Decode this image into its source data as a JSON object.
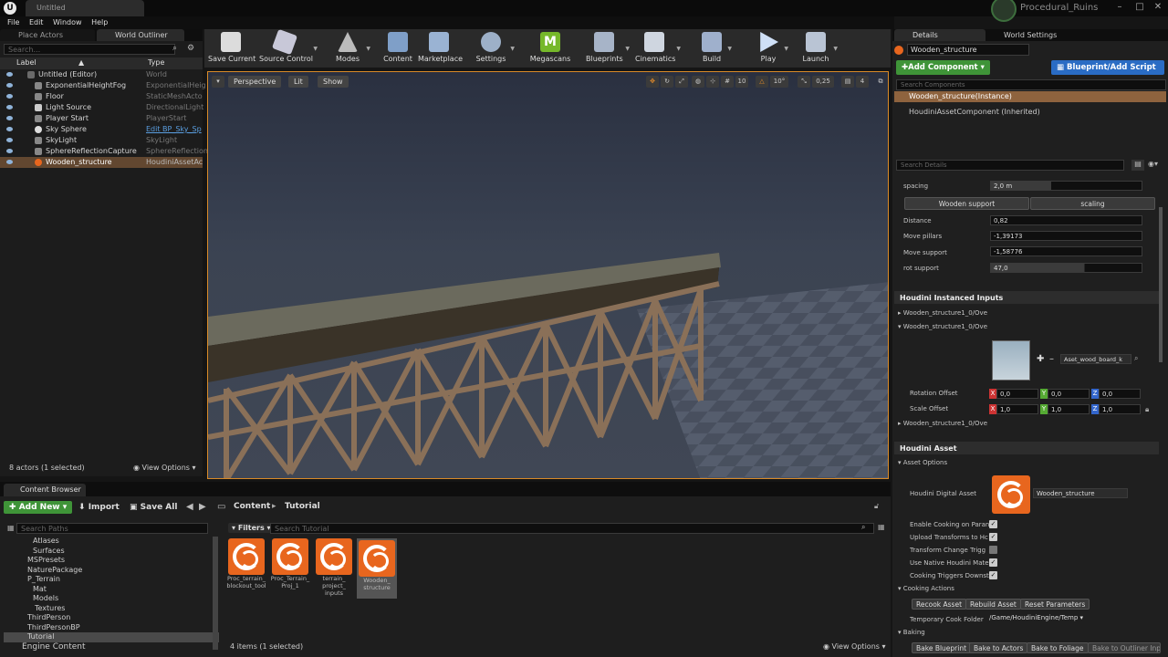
{
  "window": {
    "doc_tab": "Untitled",
    "project": "Procedural_Ruins",
    "logo": "U"
  },
  "menu": [
    "File",
    "Edit",
    "Window",
    "Help"
  ],
  "outliner": {
    "tabs": [
      "Place Actors",
      "World Outliner"
    ],
    "search_placeholder": "Search...",
    "col_label": "Label",
    "col_type": "Type",
    "rows": [
      {
        "label": "Untitled (Editor)",
        "type": "World"
      },
      {
        "label": "ExponentialHeightFog",
        "type": "ExponentialHeig"
      },
      {
        "label": "Floor",
        "type": "StaticMeshActo"
      },
      {
        "label": "Light Source",
        "type": "DirectionalLight"
      },
      {
        "label": "Player Start",
        "type": "PlayerStart"
      },
      {
        "label": "Sky Sphere",
        "type": "Edit BP_Sky_Sp"
      },
      {
        "label": "SkyLight",
        "type": "SkyLight"
      },
      {
        "label": "SphereReflectionCapture",
        "type": "SphereReflection"
      },
      {
        "label": "Wooden_structure",
        "type": "HoudiniAssetAc"
      }
    ],
    "status": "8 actors (1 selected)",
    "view_options": "View Options"
  },
  "toolbar": [
    "Save Current",
    "Source Control",
    "Modes",
    "Content",
    "Marketplace",
    "Settings",
    "Megascans",
    "Blueprints",
    "Cinematics",
    "Build",
    "Play",
    "Launch"
  ],
  "viewport": {
    "perspective": "Perspective",
    "lit": "Lit",
    "show": "Show",
    "grid": "10",
    "angle": "10°",
    "scale": "0,25",
    "cam": "4"
  },
  "content_browser": {
    "tab": "Content Browser",
    "add_new": "Add New",
    "import": "Import",
    "save_all": "Save All",
    "path": [
      "Content",
      "Tutorial"
    ],
    "search_paths": "Search Paths",
    "filters": "Filters",
    "search_placeholder": "Search Tutorial",
    "tree": [
      "Atlases",
      "Surfaces",
      "MSPresets",
      "NaturePackage",
      "P_Terrain",
      "Mat",
      "Models",
      "Textures",
      "ThirdPerson",
      "ThirdPersonBP",
      "Tutorial",
      "Engine Content"
    ],
    "assets": [
      "Proc_terrain_ blockout_tool",
      "Proc_Terrain_ Proj_1",
      "terrain_ project_ inputs",
      "Wooden_ structure"
    ],
    "status": "4 items (1 selected)",
    "view_options": "View Options"
  },
  "details": {
    "tabs": [
      "Details",
      "World Settings"
    ],
    "name": "Wooden_structure",
    "add_component": "Add Component",
    "blueprint_btn": "Blueprint/Add Script",
    "search_components": "Search Components",
    "component_instance": "Wooden_structure(Instance)",
    "component_child": "HoudiniAssetComponent (Inherited)",
    "search_details": "Search Details",
    "spacing_label": "spacing",
    "spacing_value": "2,0 m",
    "tab_support": "Wooden support",
    "tab_scaling": "scaling",
    "params": [
      {
        "label": "Distance",
        "value": "0,82"
      },
      {
        "label": "Move pillars",
        "value": "-1,39173"
      },
      {
        "label": "Move support",
        "value": "-1,58776"
      },
      {
        "label": "rot support",
        "value": "47,0"
      }
    ],
    "instanced_title": "Houdini Instanced Inputs",
    "instanced_rows": [
      "Wooden_structure1_0/Ove",
      "Wooden_structure1_0/Ove",
      "Wooden_structure1_0/Ove"
    ],
    "asset_dropdown": "Aset_wood_board_k",
    "rotation_label": "Rotation Offset",
    "scale_label": "Scale Offset",
    "rotation": [
      "0,0",
      "0,0",
      "0,0"
    ],
    "scale": [
      "1,0",
      "1,0",
      "1,0"
    ],
    "houdini_asset_title": "Houdini Asset",
    "asset_options": "Asset Options",
    "hda_label": "Houdini Digital Asset",
    "hda_value": "Wooden_structure",
    "checks": [
      {
        "label": "Enable Cooking on Paran",
        "on": true
      },
      {
        "label": "Upload Transforms to Hc",
        "on": true
      },
      {
        "label": "Transform Change Trigg",
        "on": false
      },
      {
        "label": "Use Native Houdini Mate",
        "on": true
      },
      {
        "label": "Cooking Triggers Downst",
        "on": true
      }
    ],
    "cooking_actions": "Cooking Actions",
    "cook_btns": [
      "Recook Asset",
      "Rebuild Asset",
      "Reset Parameters"
    ],
    "temp_folder_label": "Temporary Cook Folder",
    "temp_folder_value": "/Game/HoudiniEngine/Temp",
    "baking": "Baking",
    "bake_btns": [
      "Bake Blueprint",
      "Bake to Actors",
      "Bake to Foliage",
      "Bake to Outliner Inp"
    ]
  },
  "colors": {
    "accent": "#d98a27",
    "houdini": "#e8661e",
    "green": "#3f9438",
    "blue": "#2a6cc4"
  }
}
